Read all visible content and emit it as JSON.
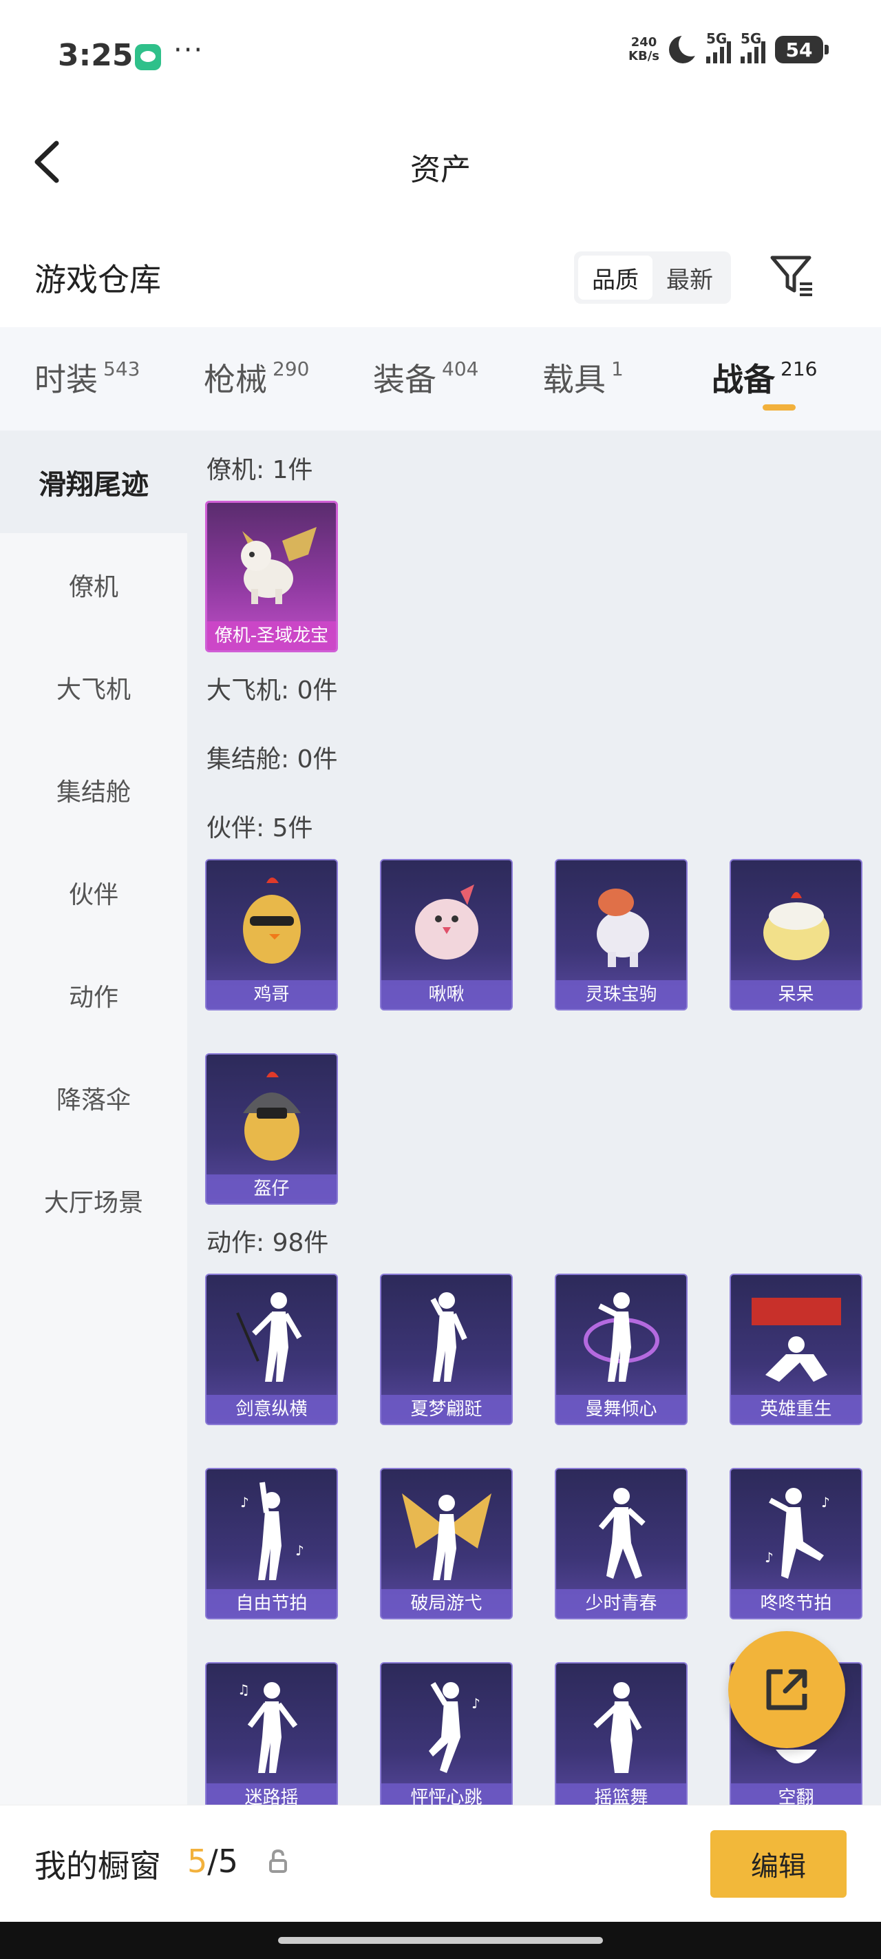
{
  "status_bar": {
    "time": "3:25",
    "net_speed": "240",
    "net_speed_unit": "KB/s",
    "sig1": "5G",
    "sig2": "5G",
    "battery": "54"
  },
  "nav": {
    "title": "资产"
  },
  "warehouse": {
    "title": "游戏仓库",
    "sort_options": [
      "品质",
      "最新"
    ],
    "active_sort": "品质"
  },
  "tabs": [
    {
      "label": "时装",
      "count": "543"
    },
    {
      "label": "枪械",
      "count": "290"
    },
    {
      "label": "装备",
      "count": "404"
    },
    {
      "label": "载具",
      "count": "1"
    },
    {
      "label": "战备",
      "count": "216"
    }
  ],
  "active_tab": "战备",
  "sidebar": [
    "滑翔尾迹",
    "僚机",
    "大飞机",
    "集结舱",
    "伙伴",
    "动作",
    "降落伞",
    "大厅场景"
  ],
  "active_sidebar": "滑翔尾迹",
  "sections": {
    "wingman": {
      "title": "僚机: 1件",
      "items": [
        "僚机-圣域龙宝"
      ]
    },
    "plane": {
      "title": "大飞机: 0件"
    },
    "pod": {
      "title": "集结舱: 0件"
    },
    "partner": {
      "title": "伙伴: 5件",
      "items": [
        "鸡哥",
        "啾啾",
        "灵珠宝驹",
        "呆呆",
        "盔仔"
      ]
    },
    "emote": {
      "title": "动作: 98件",
      "items": [
        "剑意纵横",
        "夏梦翩跹",
        "曼舞倾心",
        "英雄重生",
        "自由节拍",
        "破局游弋",
        "少时青春",
        "咚咚节拍",
        "迷路摇",
        "怦怦心跳",
        "摇篮舞",
        "空翻"
      ]
    }
  },
  "bottom": {
    "label": "我的橱窗",
    "current": "5",
    "sep_total": "/5",
    "edit": "编辑"
  }
}
